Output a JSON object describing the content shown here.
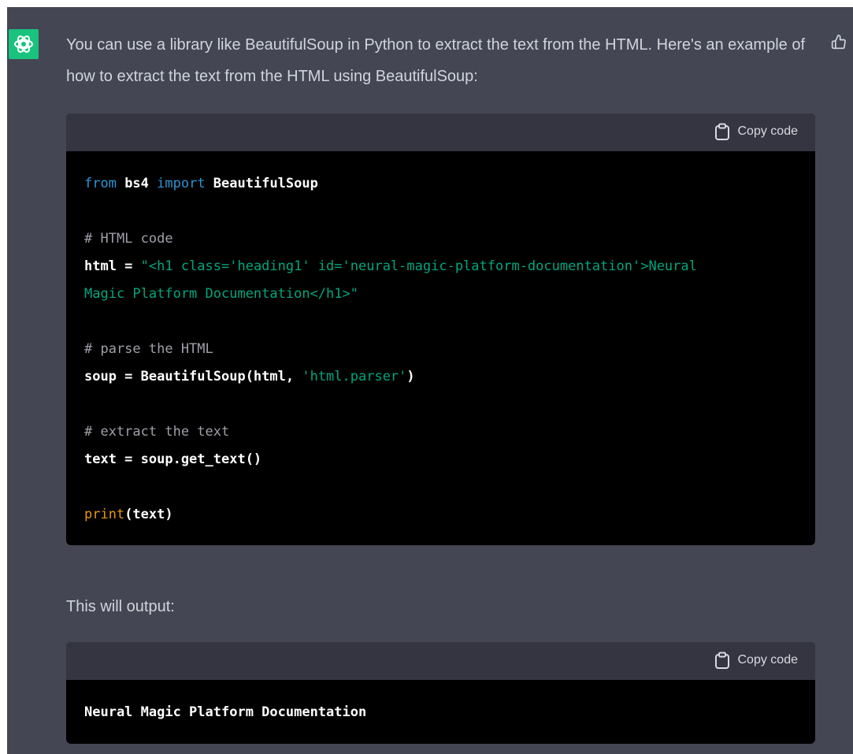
{
  "message": {
    "intro": "You can use a library like BeautifulSoup in Python to extract the text from the HTML. Here's an example of how to extract the text from the HTML using BeautifulSoup:",
    "output_intro": "This will output:"
  },
  "code_blocks": [
    {
      "copy_label": "Copy code",
      "lines": [
        [
          {
            "c": "kw",
            "t": "from"
          },
          {
            "c": "plain",
            "t": " bs4 "
          },
          {
            "c": "kw",
            "t": "import"
          },
          {
            "c": "plain",
            "t": " BeautifulSoup"
          }
        ],
        [],
        [
          {
            "c": "cm",
            "t": "# HTML code"
          }
        ],
        [
          {
            "c": "plain",
            "t": "html = "
          },
          {
            "c": "str",
            "t": "\"<h1 class='heading1' id='neural-magic-platform-documentation'>Neural"
          }
        ],
        [
          {
            "c": "str",
            "t": "Magic Platform Documentation</h1>\""
          }
        ],
        [],
        [
          {
            "c": "cm",
            "t": "# parse the HTML"
          }
        ],
        [
          {
            "c": "plain",
            "t": "soup = BeautifulSoup(html, "
          },
          {
            "c": "str",
            "t": "'html.parser'"
          },
          {
            "c": "plain",
            "t": ")"
          }
        ],
        [],
        [
          {
            "c": "cm",
            "t": "# extract the text"
          }
        ],
        [
          {
            "c": "plain",
            "t": "text = soup.get_text()"
          }
        ],
        [],
        [
          {
            "c": "fn",
            "t": "print"
          },
          {
            "c": "plain",
            "t": "(text)"
          }
        ]
      ]
    },
    {
      "copy_label": "Copy code",
      "lines": [
        [
          {
            "c": "plain",
            "t": "Neural Magic Platform Documentation"
          }
        ]
      ]
    }
  ],
  "icons": {
    "avatar": "openai-logo-icon",
    "like": "thumbs-up-icon",
    "copy": "clipboard-icon"
  },
  "colors": {
    "panel_bg": "#444654",
    "avatar_bg": "#19c37d",
    "code_header_bg": "#343541",
    "keyword": "#2e95d3",
    "string": "#00a67d",
    "comment": "#9f9fa8",
    "builtin": "#e9950c"
  }
}
